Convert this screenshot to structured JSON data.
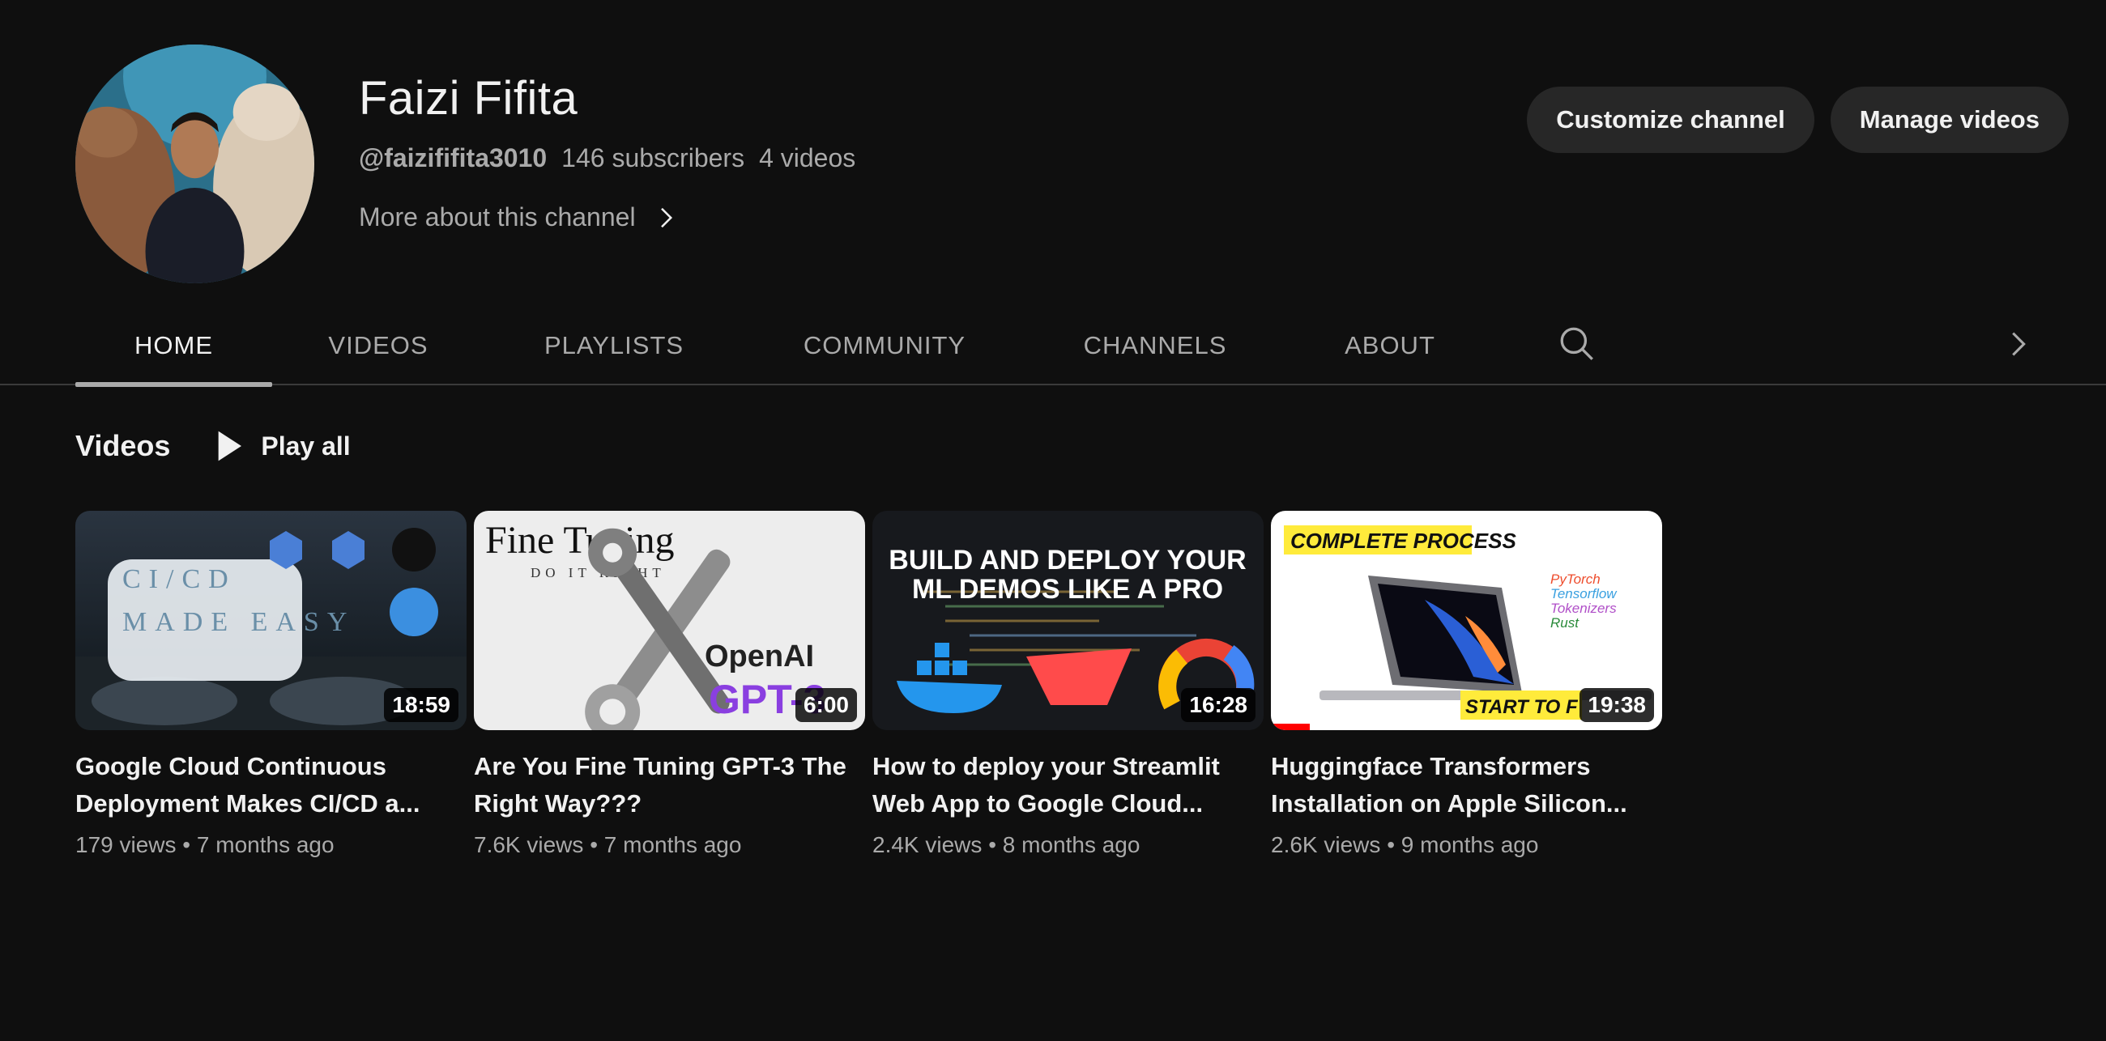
{
  "channel": {
    "name": "Faizi Fifita",
    "handle": "@faizififita3010",
    "subscribers": "146 subscribers",
    "video_count": "4 videos",
    "more_about": "More about this channel"
  },
  "buttons": {
    "customize": "Customize channel",
    "manage": "Manage videos"
  },
  "tabs": [
    {
      "label": "HOME",
      "active": true
    },
    {
      "label": "VIDEOS",
      "active": false
    },
    {
      "label": "PLAYLISTS",
      "active": false
    },
    {
      "label": "COMMUNITY",
      "active": false
    },
    {
      "label": "CHANNELS",
      "active": false
    },
    {
      "label": "ABOUT",
      "active": false
    }
  ],
  "section": {
    "title": "Videos",
    "play_all": "Play all"
  },
  "videos": [
    {
      "title": "Google Cloud Continuous Deployment Makes CI/CD a...",
      "views": "179 views",
      "age": "7 months ago",
      "duration": "18:59",
      "thumb_text": [
        "CI/CD",
        "MADE EASY"
      ],
      "watched_fraction": 0
    },
    {
      "title": "Are You Fine Tuning GPT-3 The Right Way???",
      "views": "7.6K views",
      "age": "7 months ago",
      "duration": "6:00",
      "thumb_text": [
        "Fine Tuning",
        "DO IT RIGHT",
        "OpenAI",
        "GPT-3"
      ],
      "watched_fraction": 0
    },
    {
      "title": "How to deploy your Streamlit Web App to Google Cloud...",
      "views": "2.4K views",
      "age": "8 months ago",
      "duration": "16:28",
      "thumb_text": [
        "BUILD AND DEPLOY YOUR",
        "ML DEMOS LIKE A PRO"
      ],
      "watched_fraction": 0
    },
    {
      "title": "Huggingface Transformers Installation on Apple Silicon...",
      "views": "2.6K views",
      "age": "9 months ago",
      "duration": "19:38",
      "thumb_text": [
        "COMPLETE PROCESS",
        "PyTorch",
        "Tensorflow",
        "Tokenizers",
        "Rust",
        "START TO F"
      ],
      "watched_fraction": 0.1
    }
  ],
  "colors": {
    "background": "#0f0f0f",
    "button_bg": "#272727",
    "text_primary": "#f1f1f1",
    "text_secondary": "#aaaaaa",
    "progress": "#ff0000"
  }
}
